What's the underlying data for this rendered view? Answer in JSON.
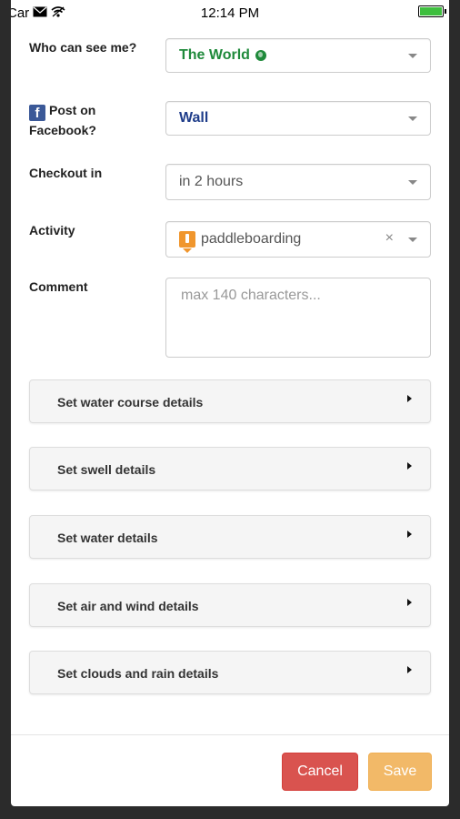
{
  "status_bar": {
    "carrier": "Car",
    "time": "12:14 PM",
    "battery_level": 1.0,
    "icons": [
      "mail-icon",
      "wifi-icon",
      "battery-icon"
    ]
  },
  "form": {
    "visibility": {
      "label": "Who can see me?",
      "value": "The World",
      "value_color": "#1f8a3b",
      "icon": "globe-icon"
    },
    "facebook": {
      "label": "Post on Facebook?",
      "value": "Wall",
      "value_color": "#1f3d8a",
      "icon": "facebook-icon"
    },
    "checkout": {
      "label": "Checkout in",
      "value": "in 2 hours"
    },
    "activity": {
      "label": "Activity",
      "value": "paddleboarding",
      "clear": "×",
      "icon": "paddleboarding-icon"
    },
    "comment": {
      "label": "Comment",
      "placeholder": "max 140 characters..."
    }
  },
  "panels": [
    {
      "title": "Set water course details"
    },
    {
      "title": "Set swell details"
    },
    {
      "title": "Set water details"
    },
    {
      "title": "Set air and wind details"
    },
    {
      "title": "Set clouds and rain details"
    }
  ],
  "buttons": {
    "cancel": "Cancel",
    "save": "Save"
  },
  "colors": {
    "cancel": "#d9534f",
    "save": "#f0ad4e",
    "panel_bg": "#f5f5f5"
  }
}
